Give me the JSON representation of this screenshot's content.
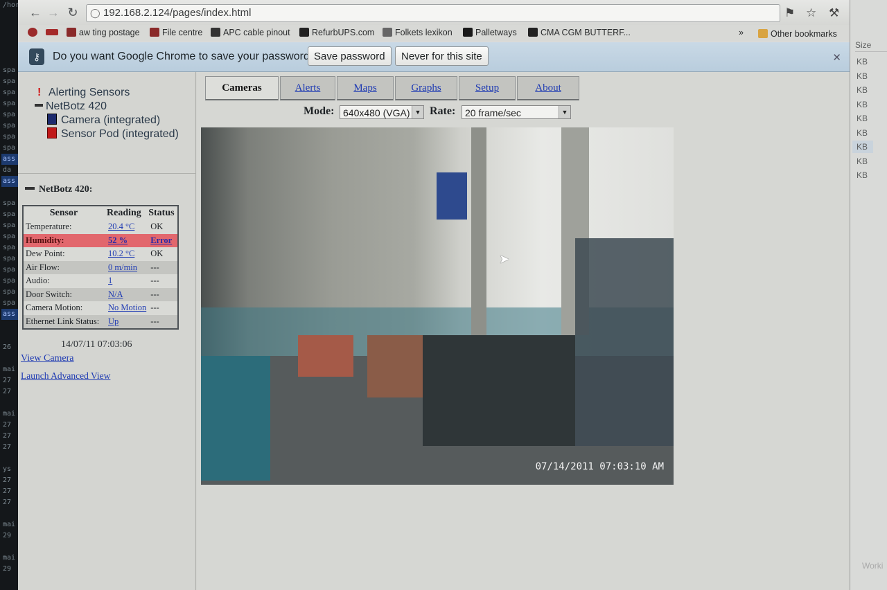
{
  "browser": {
    "url": "192.168.2.124/pages/index.html",
    "bookmarks": [
      {
        "label": "aw ting postage",
        "color": "#8a2a2a"
      },
      {
        "label": "File centre",
        "color": "#8a2a2a"
      },
      {
        "label": "APC cable pinout",
        "color": "#333333"
      },
      {
        "label": "RefurbUPS.com",
        "color": "#222222"
      },
      {
        "label": "Folkets lexikon",
        "color": "#666666"
      },
      {
        "label": "Palletways",
        "color": "#1a1a1a"
      },
      {
        "label": "CMA CGM BUTTERF...",
        "color": "#222222"
      }
    ],
    "more": "»",
    "other_bookmarks": "Other bookmarks"
  },
  "infobar": {
    "message": "Do you want Google Chrome to save your password?",
    "save_label": "Save password",
    "never_label": "Never for this site",
    "close": "✕"
  },
  "tree": {
    "alerting": "Alerting Sensors",
    "device": "NetBotz 420",
    "camera": "Camera (integrated)",
    "sensor_pod": "Sensor Pod (integrated)"
  },
  "netbotz_title": "NetBotz 420:",
  "table": {
    "headers": [
      "Sensor",
      "Reading",
      "Status"
    ],
    "rows": [
      {
        "sensor": "Temperature:",
        "reading": "20.4 °C",
        "status": "OK"
      },
      {
        "sensor": "Humidity:",
        "reading": "52 %",
        "status": "Error"
      },
      {
        "sensor": "Dew Point:",
        "reading": "10.2 °C",
        "status": "OK"
      },
      {
        "sensor": "Air Flow:",
        "reading": "0 m/min",
        "status": "---"
      },
      {
        "sensor": "Audio:",
        "reading": "1",
        "status": "---"
      },
      {
        "sensor": "Door Switch:",
        "reading": "N/A",
        "status": "---"
      },
      {
        "sensor": "Camera Motion:",
        "reading": "No Motion",
        "status": "---"
      },
      {
        "sensor": "Ethernet Link Status:",
        "reading": "Up",
        "status": "---"
      }
    ]
  },
  "timestamp": "14/07/11 07:03:06",
  "links": {
    "view_camera": "View Camera",
    "advanced": "Launch Advanced View"
  },
  "tabs": [
    "Cameras",
    "Alerts",
    "Maps",
    "Graphs",
    "Setup",
    "About"
  ],
  "camera_controls": {
    "mode_label": "Mode:",
    "mode_value": "640x480 (VGA)",
    "rate_label": "Rate:",
    "rate_value": "20 frame/sec"
  },
  "camera_timestamp": "07/14/2011 07:03:10 AM",
  "background_window": {
    "header": "Size",
    "sizes": [
      "KB",
      "KB",
      "KB",
      "KB",
      "KB",
      "KB",
      "KB",
      "KB",
      "KB"
    ],
    "status": "Worki"
  },
  "terminal": {
    "top": "/hor",
    "lines": [
      "",
      "",
      "",
      "spa",
      "spa",
      "spa",
      "spa",
      "spa",
      "spa",
      "spa",
      "spa",
      "ass",
      "da",
      "ass",
      "",
      "spa",
      "spa",
      "spa",
      "spa",
      "spa",
      "spa",
      "spa",
      "spa",
      "spa",
      "spa",
      "ass",
      "",
      "",
      "26",
      "",
      "mai",
      "27",
      "27",
      "",
      "mai",
      "27",
      "27",
      "27",
      "",
      "ys",
      "27",
      "27",
      "27",
      "",
      "mai",
      "29",
      "",
      "mai",
      "29"
    ]
  },
  "colors": {
    "link": "#1f3bb3",
    "error_row": "#e2676d",
    "infobar": "#c2d4e2"
  }
}
